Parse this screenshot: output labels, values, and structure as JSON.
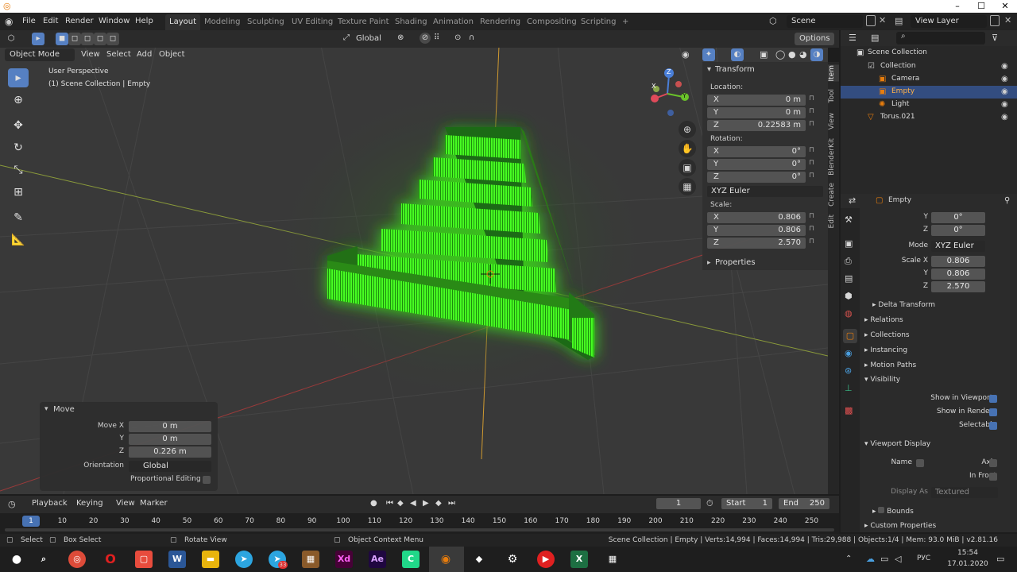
{
  "window": {
    "minimize": "–",
    "maximize": "☐",
    "close": "✕"
  },
  "menu": [
    "File",
    "Edit",
    "Render",
    "Window",
    "Help"
  ],
  "workspaces": [
    "Layout",
    "Modeling",
    "Sculpting",
    "UV Editing",
    "Texture Paint",
    "Shading",
    "Animation",
    "Rendering",
    "Compositing",
    "Scripting",
    "+"
  ],
  "scene": {
    "name": "Scene",
    "view_layer": "View Layer"
  },
  "viewport_header": {
    "mode": "Object Mode",
    "menus": [
      "View",
      "Select",
      "Add",
      "Object"
    ],
    "orientation": "Global",
    "options": "Options"
  },
  "viewport": {
    "perspective": "User Perspective",
    "context": "(1) Scene Collection | Empty"
  },
  "gizmo": {
    "x": "X",
    "y": "Y",
    "z": "Z"
  },
  "npanel": {
    "tabs": [
      "Item",
      "Tool",
      "View",
      "BlenderKit",
      "Create",
      "Edit"
    ],
    "transform_title": "Transform",
    "location_label": "Location:",
    "location": [
      {
        "axis": "X",
        "value": "0 m"
      },
      {
        "axis": "Y",
        "value": "0 m"
      },
      {
        "axis": "Z",
        "value": "0.22583 m"
      }
    ],
    "rotation_label": "Rotation:",
    "rotation": [
      {
        "axis": "X",
        "value": "0°"
      },
      {
        "axis": "Y",
        "value": "0°"
      },
      {
        "axis": "Z",
        "value": "0°"
      }
    ],
    "rotation_mode": "XYZ Euler",
    "scale_label": "Scale:",
    "scale": [
      {
        "axis": "X",
        "value": "0.806"
      },
      {
        "axis": "Y",
        "value": "0.806"
      },
      {
        "axis": "Z",
        "value": "2.570"
      }
    ],
    "properties_title": "Properties"
  },
  "move_panel": {
    "title": "Move",
    "move_x_label": "Move X",
    "move_x": "0 m",
    "y_label": "Y",
    "y": "0 m",
    "z_label": "Z",
    "z": "0.226 m",
    "orientation_label": "Orientation",
    "orientation": "Global",
    "proportional": "Proportional Editing"
  },
  "outliner": {
    "root": "Scene Collection",
    "items": [
      {
        "name": "Collection",
        "indent": 1
      },
      {
        "name": "Camera",
        "indent": 2
      },
      {
        "name": "Empty",
        "indent": 2,
        "selected": true
      },
      {
        "name": "Light",
        "indent": 2
      },
      {
        "name": "Torus.021",
        "indent": 1
      }
    ]
  },
  "properties": {
    "object_name": "Empty",
    "rot_y_label": "Y",
    "rot_y": "0°",
    "rot_z_label": "Z",
    "rot_z": "0°",
    "mode_label": "Mode",
    "mode": "XYZ Euler",
    "scale_x_label": "Scale X",
    "scale_x": "0.806",
    "scale_y_label": "Y",
    "scale_y": "0.806",
    "scale_z_label": "Z",
    "scale_z": "2.570",
    "delta": "Delta Transform",
    "sections": [
      "Relations",
      "Collections",
      "Instancing",
      "Motion Paths"
    ],
    "visibility": "Visibility",
    "show_viewports": "Show in Viewports",
    "show_renders": "Show in Renders",
    "selectable": "Selectable",
    "viewport_display": "Viewport Display",
    "name_label": "Name",
    "axis_label": "Axis",
    "in_front": "In Front",
    "display_as_label": "Display As",
    "display_as": "Textured",
    "bounds": "Bounds",
    "custom": "Custom Properties"
  },
  "timeline": {
    "menus": [
      "Playback",
      "Keying",
      "View",
      "Marker"
    ],
    "current_frame": "1",
    "start_label": "Start",
    "start": "1",
    "end_label": "End",
    "end": "250",
    "ticks": [
      "1",
      "10",
      "20",
      "30",
      "40",
      "50",
      "60",
      "70",
      "80",
      "90",
      "100",
      "110",
      "120",
      "130",
      "140",
      "150",
      "160",
      "170",
      "180",
      "190",
      "200",
      "210",
      "220",
      "230",
      "240",
      "250"
    ]
  },
  "status": {
    "select": "Select",
    "box_select": "Box Select",
    "rotate_view": "Rotate View",
    "context_menu": "Object Context Menu",
    "stats": "Scene Collection | Empty | Verts:14,994 | Faces:14,994 | Tris:29,988 | Objects:1/4 | Mem: 93.0 MiB | v2.81.16"
  },
  "taskbar": {
    "lang": "РУС",
    "time": "15:54",
    "date": "17.01.2020",
    "badge": "33"
  },
  "colors": {
    "accent": "#4772b3",
    "green": "#3cf01e",
    "orange": "#e87d0d"
  }
}
